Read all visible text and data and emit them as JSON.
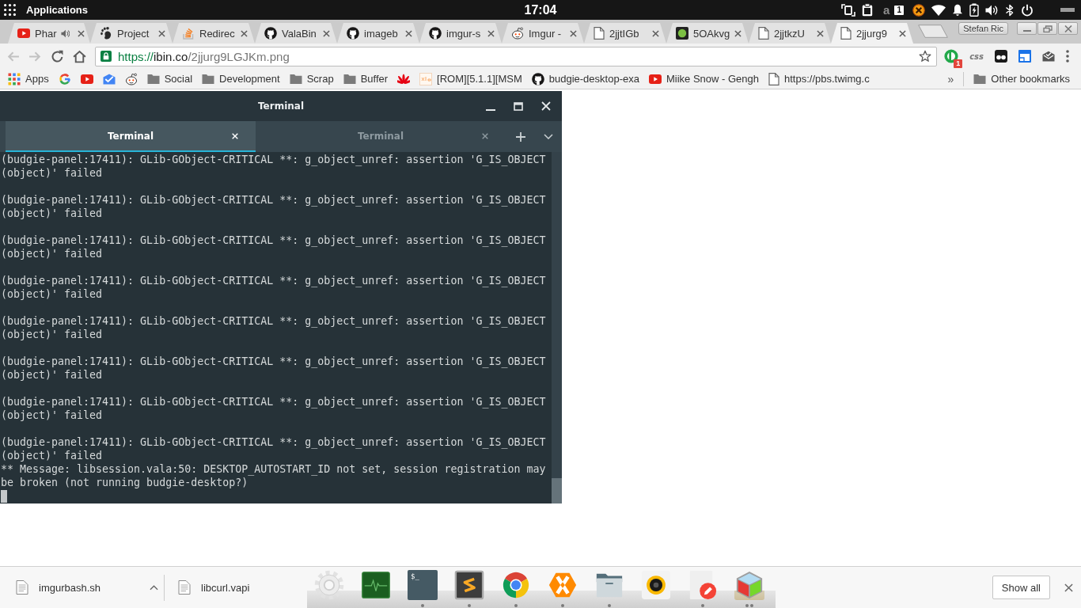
{
  "top_panel": {
    "menu_label": "Applications",
    "clock": "17:04",
    "tray": [
      {
        "kind": "screen-rotate"
      },
      {
        "kind": "clipboard"
      },
      {
        "kind": "letter",
        "label": "a"
      },
      {
        "kind": "number",
        "label": "1"
      },
      {
        "kind": "chat"
      },
      {
        "kind": "wifi"
      },
      {
        "kind": "bell"
      },
      {
        "kind": "battery"
      },
      {
        "kind": "volume"
      },
      {
        "kind": "bluetooth"
      },
      {
        "kind": "power"
      },
      {
        "kind": "bar"
      }
    ]
  },
  "browser": {
    "tabs": [
      {
        "title": "Phar",
        "kind": "play",
        "audio": true,
        "selected": false
      },
      {
        "title": "Project",
        "kind": "foot",
        "audio": false,
        "selected": false
      },
      {
        "title": "Redirec",
        "kind": "stack",
        "audio": false,
        "selected": false
      },
      {
        "title": "ValaBin",
        "kind": "cat",
        "audio": false,
        "selected": false
      },
      {
        "title": "imageb",
        "kind": "cat",
        "audio": false,
        "selected": false
      },
      {
        "title": "imgur-s",
        "kind": "cat",
        "audio": false,
        "selected": false
      },
      {
        "title": "Imgur -",
        "kind": "alien",
        "audio": false,
        "selected": false
      },
      {
        "title": "2jjtIGb",
        "kind": "page",
        "audio": false,
        "selected": false
      },
      {
        "title": "5OAkvg",
        "kind": "dot",
        "audio": false,
        "selected": false
      },
      {
        "title": "2jjtkzU",
        "kind": "page",
        "audio": false,
        "selected": false
      },
      {
        "title": "2jjurg9",
        "kind": "page",
        "audio": false,
        "selected": true
      }
    ],
    "profile": "Stefan Ric",
    "nav": [
      {
        "kind": "back",
        "disabled": true
      },
      {
        "kind": "forward",
        "disabled": true
      },
      {
        "kind": "reload",
        "disabled": false
      },
      {
        "kind": "home",
        "disabled": false
      }
    ],
    "address": {
      "scheme": "https://",
      "host": "ibin.co",
      "path": "/2jjurg9LGJKm.png"
    },
    "extensions": [
      {
        "kind": "ring",
        "badge": "1"
      },
      {
        "kind": "text",
        "label": "css"
      },
      {
        "kind": "eyes"
      },
      {
        "kind": "window"
      },
      {
        "kind": "envelope"
      }
    ],
    "bookmarks": [
      {
        "kind": "apps",
        "label": "Apps"
      },
      {
        "kind": "g"
      },
      {
        "kind": "play"
      },
      {
        "kind": "inbox"
      },
      {
        "kind": "alien"
      },
      {
        "kind": "folder",
        "label": "Social"
      },
      {
        "kind": "folder",
        "label": "Development"
      },
      {
        "kind": "folder",
        "label": "Scrap"
      },
      {
        "kind": "folder",
        "label": "Buffer"
      },
      {
        "kind": "petals"
      },
      {
        "kind": "tile",
        "label": "[ROM][5.1.1][MSM"
      },
      {
        "kind": "cat",
        "label": "budgie-desktop-exa"
      },
      {
        "kind": "play",
        "label": "Miike Snow - Gengh"
      },
      {
        "kind": "page",
        "label": "https://pbs.twimg.c"
      }
    ],
    "bookmarks_overflow": "»",
    "other_bookmarks": "Other bookmarks"
  },
  "terminal": {
    "title": "Terminal",
    "tabs": [
      {
        "label": "Terminal",
        "selected": true
      },
      {
        "label": "Terminal",
        "selected": false
      }
    ],
    "output": [
      {
        "kind": "critical",
        "text": "(budgie-panel:17411): GLib-GObject-CRITICAL **: g_object_unref: assertion 'G_IS_OBJECT (object)' failed"
      },
      {
        "kind": "critical",
        "text": "(budgie-panel:17411): GLib-GObject-CRITICAL **: g_object_unref: assertion 'G_IS_OBJECT (object)' failed"
      },
      {
        "kind": "critical",
        "text": "(budgie-panel:17411): GLib-GObject-CRITICAL **: g_object_unref: assertion 'G_IS_OBJECT (object)' failed"
      },
      {
        "kind": "critical",
        "text": "(budgie-panel:17411): GLib-GObject-CRITICAL **: g_object_unref: assertion 'G_IS_OBJECT (object)' failed"
      },
      {
        "kind": "critical",
        "text": "(budgie-panel:17411): GLib-GObject-CRITICAL **: g_object_unref: assertion 'G_IS_OBJECT (object)' failed"
      },
      {
        "kind": "critical",
        "text": "(budgie-panel:17411): GLib-GObject-CRITICAL **: g_object_unref: assertion 'G_IS_OBJECT (object)' failed"
      },
      {
        "kind": "critical",
        "text": "(budgie-panel:17411): GLib-GObject-CRITICAL **: g_object_unref: assertion 'G_IS_OBJECT (object)' failed"
      },
      {
        "kind": "critical",
        "text": "(budgie-panel:17411): GLib-GObject-CRITICAL **: g_object_unref: assertion 'G_IS_OBJECT (object)' failed"
      },
      {
        "kind": "message",
        "text": "** Message: libsession.vala:50: DESKTOP_AUTOSTART_ID not set, session registration may be broken (not running budgie-desktop?)"
      }
    ]
  },
  "downloads": {
    "items": [
      {
        "name": "imgurbash.sh"
      },
      {
        "name": "libcurl.vapi"
      }
    ],
    "show_all": "Show all"
  },
  "dock": {
    "items": [
      {
        "kind": "gear",
        "running": false,
        "active": false
      },
      {
        "kind": "monitor",
        "running": false,
        "active": false
      },
      {
        "kind": "terminal",
        "label": "$_",
        "running": true,
        "multiple": false,
        "active": false
      },
      {
        "kind": "editor",
        "running": true,
        "multiple": false,
        "active": false
      },
      {
        "kind": "browser",
        "running": true,
        "multiple": false,
        "active": false
      },
      {
        "kind": "chat",
        "running": true,
        "multiple": false,
        "active": false
      },
      {
        "kind": "files",
        "running": true,
        "multiple": false,
        "active": false
      },
      {
        "kind": "music",
        "running": false,
        "active": false
      },
      {
        "kind": "pencil",
        "running": true,
        "multiple": false,
        "active": false
      },
      {
        "kind": "cube",
        "running": true,
        "multiple": true,
        "active": true
      }
    ]
  }
}
